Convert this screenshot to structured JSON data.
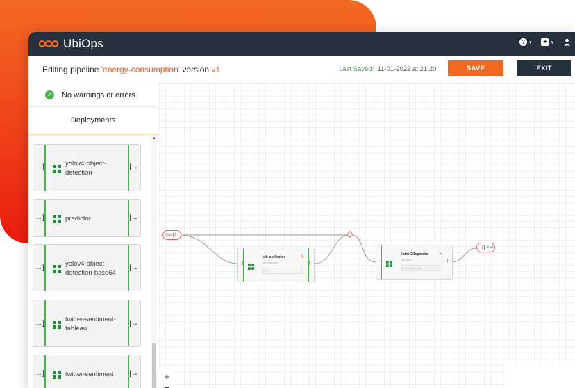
{
  "app": {
    "name": "UbiOps",
    "help_label": "?",
    "add_label": "+"
  },
  "header": {
    "title_prefix": "Editing pipeline ",
    "pipeline_name": "'energy-consumption'",
    "title_mid": " version ",
    "version": "v1",
    "last_saved_label": "Last Saved:",
    "last_saved_value": "11-01-2022 at 21:20",
    "save_label": "SAVE",
    "exit_label": "EXIT"
  },
  "sidebar": {
    "status_text": "No warnings or errors",
    "tab_label": "Deployments",
    "deployments": [
      {
        "name": "yolov4-object-detection"
      },
      {
        "name": "predictor"
      },
      {
        "name": "yolov4-object-detection-base64"
      },
      {
        "name": "twitter-sentiment-tableau"
      },
      {
        "name": "twitter-sentiment"
      }
    ]
  },
  "canvas": {
    "start_label": "Start",
    "end_label": "End",
    "zoom_in": "+",
    "zoom_out": "−",
    "nodes": [
      {
        "title": "db-collector",
        "subtitle": "db-collector",
        "version": "v1"
      },
      {
        "title": "lstm-20epochs",
        "subtitle": "predictor",
        "version": "lstm-20epochs"
      }
    ]
  },
  "colors": {
    "accent": "#f26a22",
    "dark": "#27303d",
    "success": "#4caf50"
  }
}
